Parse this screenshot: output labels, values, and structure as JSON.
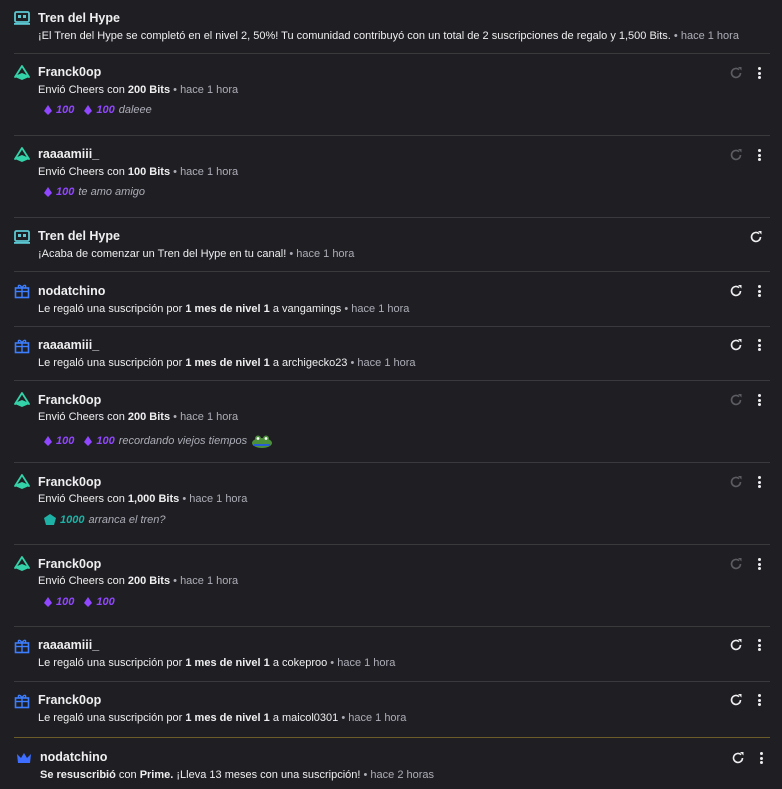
{
  "colors": {
    "background": "#1f1f23",
    "text": "#efeff1",
    "muted": "#adadb8",
    "bits_purple": "#9147ff",
    "bits_teal": "#1db2a5",
    "gift_blue": "#3d7eff",
    "hype_teal": "#5cc8d2",
    "prime_blue": "#3d6eff"
  },
  "items": [
    {
      "icon": "hype-train-icon",
      "title": "Tren del Hype",
      "text": "¡El Tren del Hype se completó en el nivel 2, 50%! Tu comunidad contribuyó con un total de 2 suscripciones de regalo y 1,500 Bits.",
      "time": "hace 1 hora"
    },
    {
      "icon": "cheer-icon",
      "title": "Franck0op",
      "pre": "Envió Cheers con ",
      "bold": "200 Bits",
      "time": "hace 1 hora",
      "cheers": [
        {
          "amount": "100",
          "msg": ""
        },
        {
          "amount": "100",
          "msg": "daleee"
        }
      ]
    },
    {
      "icon": "cheer-icon",
      "title": "raaaamiii_",
      "pre": "Envió Cheers con ",
      "bold": "100 Bits",
      "time": "hace 1 hora",
      "cheers": [
        {
          "amount": "100",
          "msg": "te amo amigo"
        }
      ]
    },
    {
      "icon": "hype-train-icon",
      "title": "Tren del Hype",
      "text": "¡Acaba de comenzar un Tren del Hype en tu canal!",
      "time": "hace 1 hora"
    },
    {
      "icon": "gift-icon",
      "title": "nodatchino",
      "pre": "Le regaló una suscripción por ",
      "bold": "1 mes de nivel 1",
      "post": " a vangamings",
      "time": "hace 1 hora"
    },
    {
      "icon": "gift-icon",
      "title": "raaaamiii_",
      "pre": "Le regaló una suscripción por ",
      "bold": "1 mes de nivel 1",
      "post": " a archigecko23",
      "time": "hace 1 hora"
    },
    {
      "icon": "cheer-icon",
      "title": "Franck0op",
      "pre": "Envió Cheers con ",
      "bold": "200 Bits",
      "time": "hace 1 hora",
      "cheers": [
        {
          "amount": "100",
          "msg": ""
        },
        {
          "amount": "100",
          "msg": "recordando viejos tiempos"
        }
      ]
    },
    {
      "icon": "cheer-icon",
      "title": "Franck0op",
      "pre": "Envió Cheers con ",
      "bold": "1,000 Bits",
      "time": "hace 1 hora",
      "cheers": [
        {
          "amount": "1000",
          "msg": "arranca el tren?"
        }
      ]
    },
    {
      "icon": "cheer-icon",
      "title": "Franck0op",
      "pre": "Envió Cheers con ",
      "bold": "200 Bits",
      "time": "hace 1 hora",
      "cheers": [
        {
          "amount": "100",
          "msg": ""
        },
        {
          "amount": "100",
          "msg": ""
        }
      ]
    },
    {
      "icon": "gift-icon",
      "title": "raaaamiii_",
      "pre": "Le regaló una suscripción por ",
      "bold": "1 mes de nivel 1",
      "post": " a cokeproo",
      "time": "hace 1 hora"
    },
    {
      "icon": "gift-icon",
      "title": "Franck0op",
      "pre": "Le regaló una suscripción por ",
      "bold": "1 mes de nivel 1",
      "post": " a maicol0301",
      "time": "hace 1 hora"
    },
    {
      "icon": "crown-icon",
      "title": "nodatchino",
      "bold_lead": "Se resuscribió",
      "pre": " con ",
      "bold": "Prime.",
      "post": " ¡Lleva 13 meses con una suscripción!",
      "time": "hace 2 horas"
    }
  ],
  "sep": " • "
}
